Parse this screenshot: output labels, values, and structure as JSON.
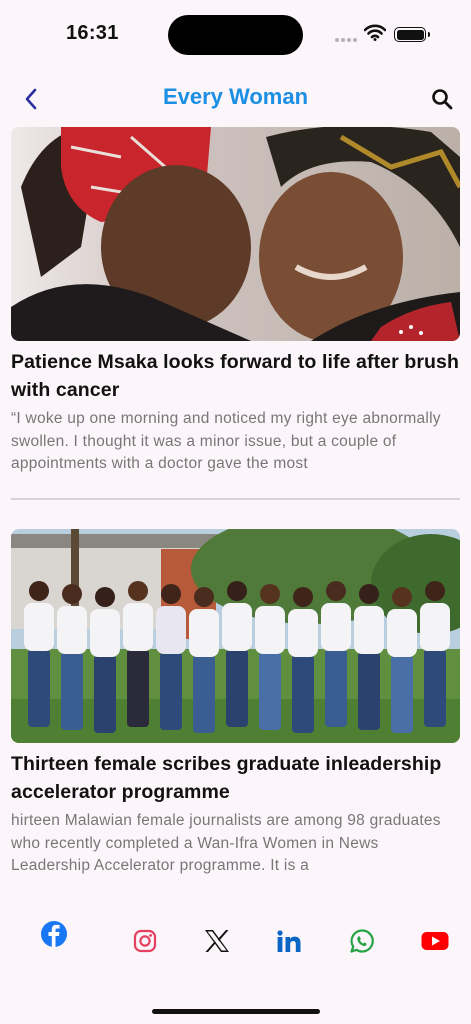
{
  "status_bar": {
    "time": "16:31"
  },
  "header": {
    "title": "Every Woman"
  },
  "articles": [
    {
      "title": "Patience Msaka looks forward to life after brush with cancer",
      "excerpt": "“I woke up one morning and noticed my right eye abnormally swollen. I thought it was a minor issue, but a couple of appointments with a doctor gave the most"
    },
    {
      "title": "Thirteen female scribes graduate inleadership accelerator programme",
      "excerpt": "hirteen Malawian female journalists are among 98 graduates who recently completed a Wan-Ifra Women in News Leadership Accelerator programme. It is a"
    }
  ],
  "social": [
    "facebook-icon",
    "instagram-icon",
    "x-icon",
    "linkedin-icon",
    "whatsapp-icon",
    "youtube-icon"
  ],
  "colors": {
    "accent": "#1a8fe3",
    "background": "#fcf5fa",
    "facebook": "#1877f2",
    "instagram": "#e4405f",
    "linkedin": "#0a66c2",
    "whatsapp": "#25a244",
    "youtube": "#ff0000"
  }
}
